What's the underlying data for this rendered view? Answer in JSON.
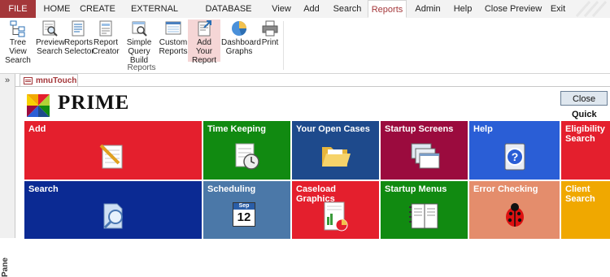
{
  "ribbon_tabs": {
    "file": "FILE",
    "home": "HOME",
    "create": "CREATE",
    "external_data": "EXTERNAL DATA",
    "database_tools": "DATABASE TOOLS",
    "view": "View",
    "add": "Add",
    "search": "Search",
    "reports": "Reports",
    "admin": "Admin",
    "help": "Help",
    "close_preview": "Close Preview",
    "exit": "Exit"
  },
  "ribbon_buttons": {
    "tree_view_search": [
      "Tree View",
      "Search"
    ],
    "preview_search": [
      "Preview",
      "Search"
    ],
    "reports_selector": [
      "Reports",
      "Selector"
    ],
    "report_creator": [
      "Report",
      "Creator"
    ],
    "simple_query_build": [
      "Simple",
      "Query Build"
    ],
    "custom_reports": [
      "Custom",
      "Reports"
    ],
    "add_your_report": [
      "Add Your",
      "Report"
    ],
    "dashboard_graphs": [
      "Dashboard",
      "Graphs"
    ],
    "print": [
      "Print",
      ""
    ]
  },
  "ribbon_group_label": "Reports",
  "nav_pane": {
    "toggle": "»",
    "label": "Pane"
  },
  "doc_tab": "mnuTouch",
  "form": {
    "brand": "PRIME",
    "close_button": "Close",
    "quick_label": "Quick"
  },
  "tiles": {
    "add": "Add",
    "time_keeping": "Time Keeping",
    "your_open_cases": "Your Open Cases",
    "startup_screens": "Startup Screens",
    "help": "Help",
    "eligibility_search": [
      "Eligibility",
      "Search"
    ],
    "search": "Search",
    "scheduling": "Scheduling",
    "caseload_graphics": "Caseload Graphics",
    "startup_menus": "Startup Menus",
    "error_checking": "Error Checking",
    "client_search": [
      "Client",
      "Search"
    ]
  },
  "calendar_icon": {
    "month": "Sep",
    "day": "12"
  },
  "colors": {
    "file_tab": "#a4373a",
    "tile_red": "#e41f2d",
    "tile_green": "#118a11",
    "tile_navy": "#1e4a8c",
    "tile_maroon": "#9b0b3e",
    "tile_blue": "#2a5ed6",
    "tile_darkblue": "#0b2a93",
    "tile_steel": "#4b78a8",
    "tile_salmon": "#e48d6c",
    "tile_orange": "#f0a800"
  }
}
